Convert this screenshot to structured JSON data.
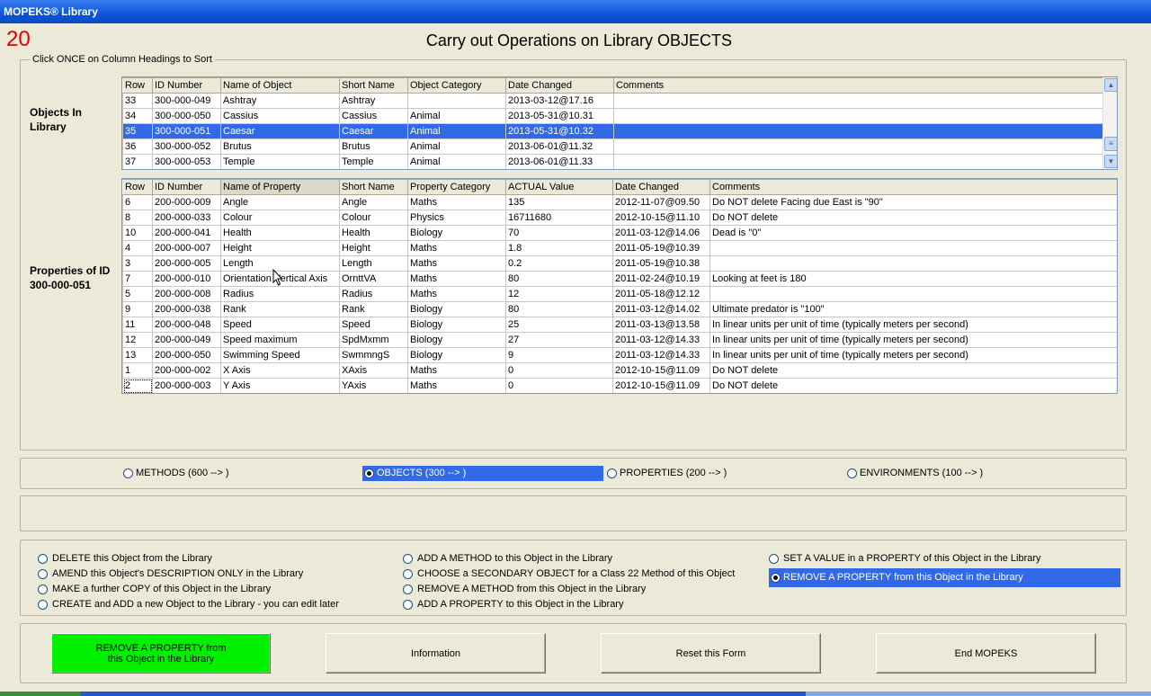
{
  "window": {
    "title": "MOPEKS® Library",
    "form_number": "20"
  },
  "page_title": "Carry out Operations on Library OBJECTS",
  "sort_hint": "Click ONCE on Column Headings to Sort",
  "objects_panel": {
    "label": "Objects In Library",
    "headers": [
      "Row",
      "ID Number",
      "Name of Object",
      "Short Name",
      "Object Category",
      "Date Changed",
      "Comments"
    ],
    "rows": [
      [
        "33",
        "300-000-049",
        "Ashtray",
        "Ashtray",
        "",
        "2013-03-12@17.16",
        ""
      ],
      [
        "34",
        "300-000-050",
        "Cassius",
        "Cassius",
        "Animal",
        "2013-05-31@10.31",
        ""
      ],
      [
        "35",
        "300-000-051",
        "Caesar",
        "Caesar",
        "Animal",
        "2013-05-31@10.32",
        ""
      ],
      [
        "36",
        "300-000-052",
        "Brutus",
        "Brutus",
        "Animal",
        "2013-06-01@11.32",
        ""
      ],
      [
        "37",
        "300-000-053",
        "Temple",
        "Temple",
        "Animal",
        "2013-06-01@11.33",
        ""
      ]
    ],
    "selected_row": 2
  },
  "properties_panel": {
    "label": "Properties of ID 300-000-051",
    "headers": [
      "Row",
      "ID Number",
      "Name of Property",
      "Short Name",
      "Property Category",
      "ACTUAL Value",
      "Date Changed",
      "Comments"
    ],
    "rows": [
      [
        "6",
        "200-000-009",
        "Angle",
        "Angle",
        "Maths",
        "135",
        "2012-11-07@09.50",
        "Do NOT delete     Facing due East is \"90\""
      ],
      [
        "8",
        "200-000-033",
        "Colour",
        "Colour",
        "Physics",
        "16711680",
        "2012-10-15@11.10",
        "Do NOT delete"
      ],
      [
        "10",
        "200-000-041",
        "Health",
        "Health",
        "Biology",
        "70",
        "2011-03-12@14.06",
        "Dead is \"0\""
      ],
      [
        "4",
        "200-000-007",
        "Height",
        "Height",
        "Maths",
        "1.8",
        "2011-05-19@10.39",
        ""
      ],
      [
        "3",
        "200-000-005",
        "Length",
        "Length",
        "Maths",
        "0.2",
        "2011-05-19@10.38",
        ""
      ],
      [
        "7",
        "200-000-010",
        "Orientation Vertical Axis",
        "OrnttVA",
        "Maths",
        "80",
        "2011-02-24@10.19",
        "Looking at feet is 180"
      ],
      [
        "5",
        "200-000-008",
        "Radius",
        "Radius",
        "Maths",
        "12",
        "2011-05-18@12.12",
        ""
      ],
      [
        "9",
        "200-000-038",
        "Rank",
        "Rank",
        "Biology",
        "80",
        "2011-03-12@14.02",
        "Ultimate predator is \"100\""
      ],
      [
        "11",
        "200-000-048",
        "Speed",
        "Speed",
        "Biology",
        "25",
        "2011-03-13@13.58",
        "In linear units per unit of time (typically meters per second)"
      ],
      [
        "12",
        "200-000-049",
        "Speed maximum",
        "SpdMxmm",
        "Biology",
        "27",
        "2011-03-12@14.33",
        "In linear units per unit of time (typically meters per second)"
      ],
      [
        "13",
        "200-000-050",
        "Swimming Speed",
        "SwmmngS",
        "Biology",
        "9",
        "2011-03-12@14.33",
        "In linear units per unit of time (typically meters per second)"
      ],
      [
        "1",
        "200-000-002",
        "X Axis",
        "XAxis",
        "Maths",
        "0",
        "2012-10-15@11.09",
        "Do NOT delete"
      ],
      [
        "2",
        "200-000-003",
        "Y Axis",
        "YAxis",
        "Maths",
        "0",
        "2012-10-15@11.09",
        "Do NOT delete"
      ]
    ]
  },
  "type_options": [
    {
      "label": "METHODS (600 --> )",
      "checked": false
    },
    {
      "label": "OBJECTS (300 --> )",
      "checked": true
    },
    {
      "label": "PROPERTIES (200 --> )",
      "checked": false
    },
    {
      "label": "ENVIRONMENTS (100 --> )",
      "checked": false
    }
  ],
  "actions": [
    {
      "label": "DELETE this Object from the Library",
      "checked": false
    },
    {
      "label": "AMEND this Object's DESCRIPTION ONLY in the Library",
      "checked": false
    },
    {
      "label": "MAKE a further COPY of this Object in the Library",
      "checked": false
    },
    {
      "label": "CREATE and ADD a new Object to the Library - you can edit later",
      "checked": false
    },
    {
      "label": "ADD A METHOD to this Object in the Library",
      "checked": false
    },
    {
      "label": "CHOOSE a SECONDARY OBJECT for a Class 22 Method of this Object",
      "checked": false
    },
    {
      "label": "REMOVE A METHOD from this Object in the Library",
      "checked": false
    },
    {
      "label": "ADD A PROPERTY to this Object in the Library",
      "checked": false
    },
    {
      "label": "SET A VALUE in a PROPERTY of this Object in the Library",
      "checked": false
    },
    {
      "label": "REMOVE A PROPERTY from this Object in the Library",
      "checked": true
    }
  ],
  "buttons": {
    "execute": "REMOVE A PROPERTY from\nthis Object in the Library",
    "information": "Information",
    "reset": "Reset this Form",
    "end": "End MOPEKS"
  },
  "colors": {
    "title_bar": "#0b55d8",
    "selection": "#3169e6",
    "execute_button": "#00f000",
    "form_number": "#e00000"
  }
}
